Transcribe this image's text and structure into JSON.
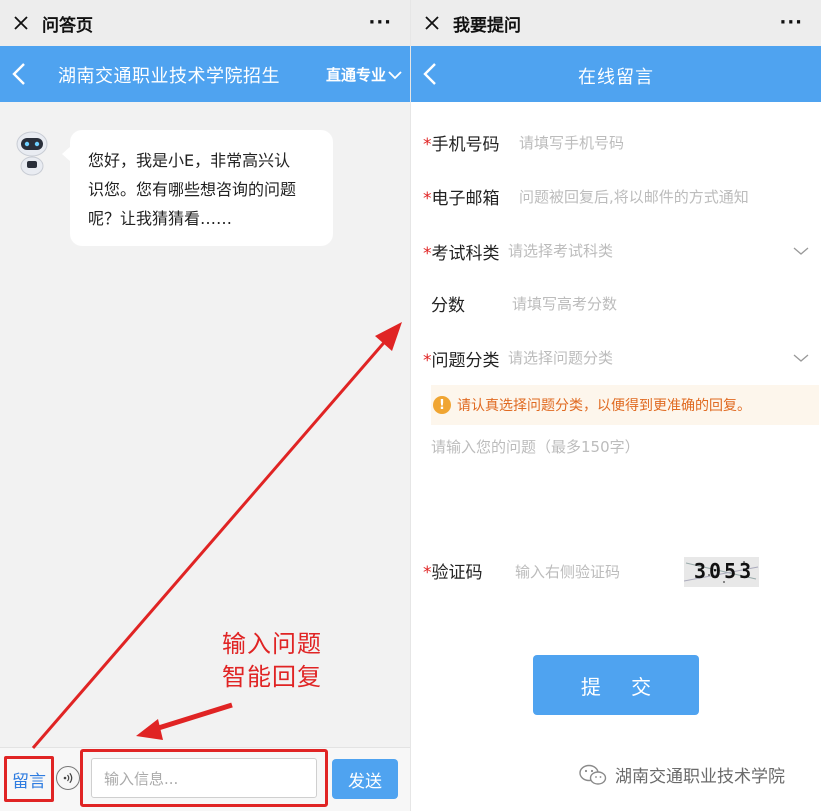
{
  "left": {
    "window_title": "问答页",
    "more_label": "···",
    "header_title": "湖南交通职业技术学院招生",
    "header_menu": "直通专业",
    "bot_message_lines": [
      "您好，我是小E，非常高兴认",
      "识您。您有哪些想咨询的问题",
      "呢？让我猜猜看……"
    ],
    "leave_message_link": "留言",
    "input_placeholder": "输入信息...",
    "send_label": "发送",
    "annotation_lines": [
      "输入问题",
      "智能回复"
    ]
  },
  "right": {
    "window_title": "我要提问",
    "more_label": "···",
    "page_title": "在线留言",
    "required_mark": "*",
    "fields": {
      "phone": {
        "label": "手机号码",
        "placeholder": "请填写手机号码"
      },
      "email": {
        "label": "电子邮箱",
        "placeholder": "问题被回复后,将以邮件的方式通知"
      },
      "exam_category": {
        "label": "考试科类",
        "placeholder": "请选择考试科类"
      },
      "score": {
        "label": "分数",
        "placeholder": "请填写高考分数"
      },
      "question_category": {
        "label": "问题分类",
        "placeholder": "请选择问题分类"
      },
      "captcha": {
        "label": "验证码",
        "placeholder": "输入右侧验证码"
      }
    },
    "notice_icon": "!",
    "notice_text": "请认真选择问题分类，以便得到更准确的回复。",
    "question_placeholder": "请输入您的问题（最多150字）",
    "captcha_text": "3053",
    "submit_label": "提 交"
  },
  "watermark": "湖南交通职业技术学院",
  "colors": {
    "accent_blue": "#4fa3f0",
    "annotation_red": "#e02424",
    "notice_bg": "#fdf6ec",
    "notice_text": "#e06a21"
  }
}
